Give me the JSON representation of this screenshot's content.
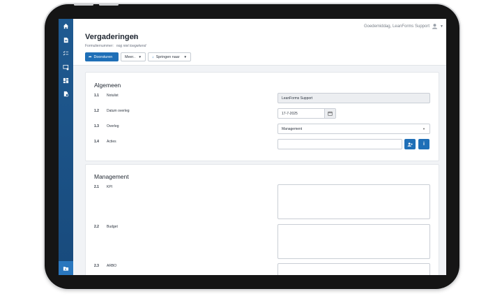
{
  "header": {
    "greeting": "Goedemiddag, LeanForms Support",
    "title": "Vergaderingen",
    "form_number_label": "Formuliernummer:",
    "form_number_value": "nog niet toegekend"
  },
  "toolbar": {
    "forward_label": "Doorsturen",
    "more_label": "Meer..",
    "jump_label": "Springen naar"
  },
  "sidebar": {
    "items": [
      {
        "icon": "home-icon"
      },
      {
        "icon": "document-icon"
      },
      {
        "icon": "checklist-icon"
      },
      {
        "icon": "screen-settings-icon"
      },
      {
        "icon": "dashboard-icon"
      },
      {
        "icon": "gear-document-icon"
      }
    ],
    "bottom_icon": "folder-icon"
  },
  "sections": {
    "general": {
      "title": "Algemeen",
      "fields": [
        {
          "num": "1.1",
          "label": "Notulist",
          "value": "LeanForms Support"
        },
        {
          "num": "1.2",
          "label": "Datum overleg",
          "value": "17-7-2025"
        },
        {
          "num": "1.3",
          "label": "Overleg",
          "value": "Management"
        },
        {
          "num": "1.4",
          "label": "Acties",
          "value": ""
        }
      ]
    },
    "management": {
      "title": "Management",
      "fields": [
        {
          "num": "2.1",
          "label": "KPI",
          "value": ""
        },
        {
          "num": "2.2",
          "label": "Budget",
          "value": ""
        },
        {
          "num": "2.3",
          "label": "ARBO",
          "value": ""
        }
      ]
    }
  },
  "colors": {
    "sidebar": "#1f5a91",
    "primary": "#1f6fb7",
    "background": "#f1f3f6"
  }
}
